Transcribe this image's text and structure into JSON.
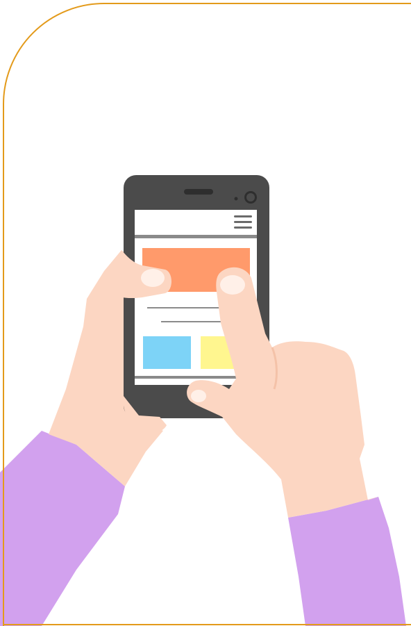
{
  "colors": {
    "frame_border": "#E39A1A",
    "background": "#FFFFFF",
    "phone_body": "#4B4B4B",
    "phone_screen": "#FFFFFF",
    "banner": "#FF9A6B",
    "tile_blue": "#7DD3F7",
    "tile_yellow": "#FFF68F",
    "skin": "#FCD6C2",
    "skin_shadow": "#F4C2A8",
    "nail": "#FFF0E8",
    "sleeve": "#D2A1EE",
    "line_gray": "#8A8A8A"
  },
  "icons": {
    "menu": "hamburger-menu-icon",
    "camera": "front-camera-icon",
    "speaker": "earpiece-speaker-icon"
  }
}
